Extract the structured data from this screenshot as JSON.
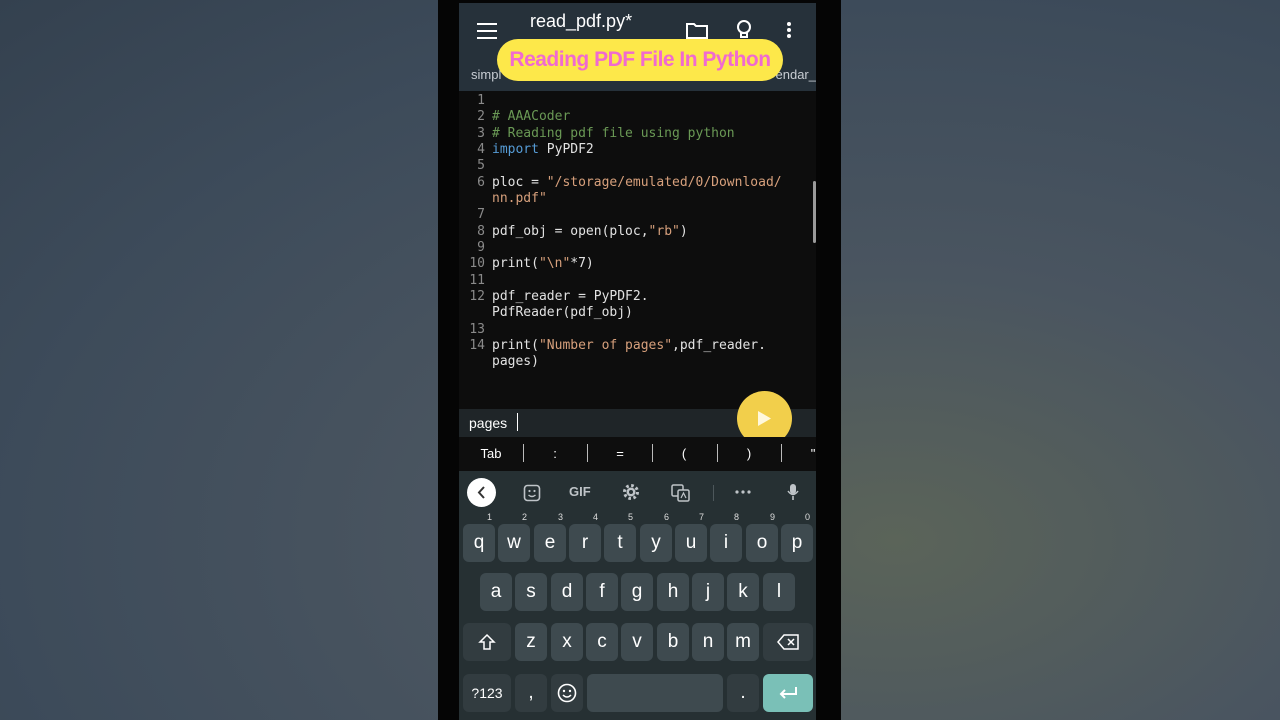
{
  "editor": {
    "file_title": "read_pdf.py*",
    "banner": "Reading PDF File In Python",
    "tab_left": "simpl",
    "tab_right": "endar_",
    "line_numbers": [
      "1",
      "2",
      "3",
      "4",
      "5",
      "6",
      "7",
      "8",
      "9",
      "10",
      "11",
      "12",
      "13",
      "14"
    ],
    "lines": {
      "l2": "# AAACoder",
      "l3": "# Reading pdf file using python",
      "l4_kw": "import",
      "l4_rest": " PyPDF2",
      "l6a": "ploc = ",
      "l6b": "\"/storage/emulated/0/Download/",
      "l6c": "nn.pdf\"",
      "l8a": "pdf_obj = open(ploc,",
      "l8b": "\"rb\"",
      "l8c": ")",
      "l10a": "print(",
      "l10b": "\"\\n\"",
      "l10c": "*7)",
      "l12a": "pdf_reader = PyPDF2.",
      "l12b": "PdfReader(pdf_obj)",
      "l14a": "print(",
      "l14b": "\"Number of pages\"",
      "l14c": ",pdf_reader.",
      "l14d": "pages)"
    }
  },
  "suggestion": {
    "text": "pages"
  },
  "symbol_bar": [
    "Tab",
    ":",
    "=",
    "(",
    ")",
    "\""
  ],
  "keyboard": {
    "toolbar": {
      "gif": "GIF"
    },
    "row1": [
      {
        "key": "q",
        "num": "1"
      },
      {
        "key": "w",
        "num": "2"
      },
      {
        "key": "e",
        "num": "3"
      },
      {
        "key": "r",
        "num": "4"
      },
      {
        "key": "t",
        "num": "5"
      },
      {
        "key": "y",
        "num": "6"
      },
      {
        "key": "u",
        "num": "7"
      },
      {
        "key": "i",
        "num": "8"
      },
      {
        "key": "o",
        "num": "9"
      },
      {
        "key": "p",
        "num": "0"
      }
    ],
    "row2": [
      "a",
      "s",
      "d",
      "f",
      "g",
      "h",
      "j",
      "k",
      "l"
    ],
    "row3": [
      "z",
      "x",
      "c",
      "v",
      "b",
      "n",
      "m"
    ],
    "bottom": {
      "symbols": "?123",
      "comma": ",",
      "period": "."
    }
  },
  "colors": {
    "banner_bg": "#fde84a",
    "banner_text": "#f06ad0",
    "fab": "#f2cf4b",
    "enter": "#7ac0b7"
  }
}
